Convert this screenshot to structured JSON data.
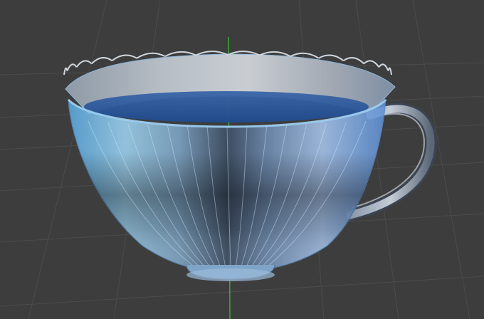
{
  "viewport": {
    "background_color": "#3d3d3d",
    "grid_color": "#4a4a4a",
    "y_axis_color": "#3fbf3f",
    "grid_visible": true
  },
  "model": {
    "shape": "teacup",
    "flutes": 16,
    "glass_tint": "#7fb6e6",
    "liquid_color": "#2f5fa4",
    "shading": "faceted"
  }
}
